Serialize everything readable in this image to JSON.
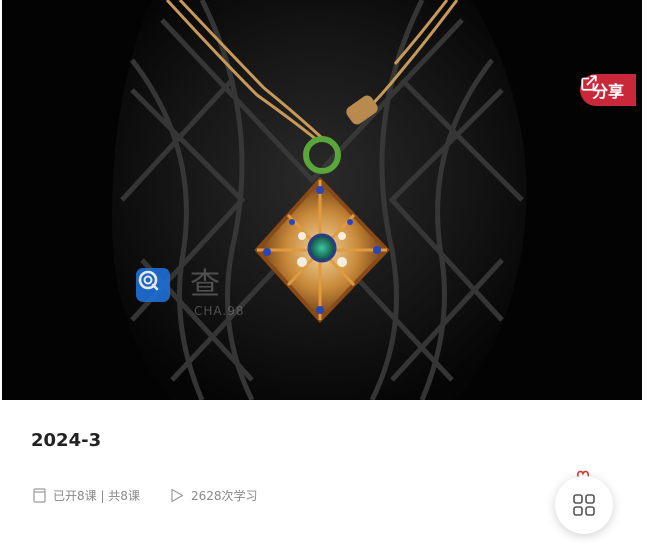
{
  "share": {
    "label": "分享",
    "icon": "external-link-icon",
    "color": "#c9283a"
  },
  "watermark": {
    "text": "查",
    "sub": "CHA.98"
  },
  "course": {
    "title": "2024-3",
    "lessons": "已开8课 | 共8课",
    "views": "2628次学习"
  },
  "fab": {
    "icon": "grid-icon"
  }
}
